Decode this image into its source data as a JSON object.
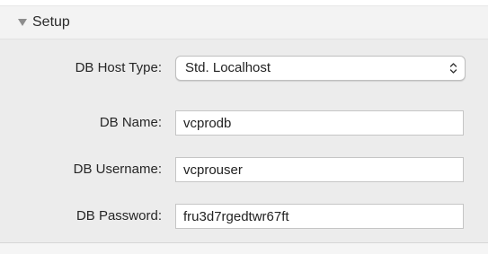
{
  "section": {
    "title": "Setup",
    "expanded": true,
    "disclosure_icon": "triangle-down-icon"
  },
  "fields": {
    "host_type": {
      "label": "DB Host Type:",
      "value": "Std. Localhost",
      "icon": "up-down-chevron-icon"
    },
    "db_name": {
      "label": "DB Name:",
      "value": "vcprodb"
    },
    "db_username": {
      "label": "DB Username:",
      "value": "vcprouser"
    },
    "db_password": {
      "label": "DB Password:",
      "value": "fru3d7rgedtwr67ft"
    }
  },
  "colors": {
    "header_bg": "#f3f3f3",
    "panel_bg": "#ececec",
    "field_border": "#c5c5c5"
  }
}
